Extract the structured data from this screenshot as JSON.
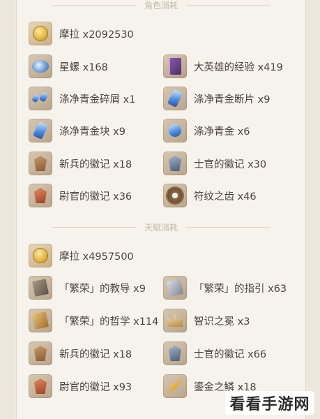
{
  "sections": [
    {
      "title": "角色消耗"
    },
    {
      "title": "天赋消耗"
    }
  ],
  "character_items": [
    {
      "icon": "mora-coin-icon",
      "label": "摩拉 x2092530"
    },
    {
      "icon": "wanderers-advice-icon",
      "label": "星螺 x168"
    },
    {
      "icon": "heros-wit-book-icon",
      "label": "大英雄的经验 x419"
    },
    {
      "icon": "gem-sliver-icon",
      "label": "涤净青金碎屑 x1"
    },
    {
      "icon": "gem-fragment-icon",
      "label": "涤净青金断片 x9"
    },
    {
      "icon": "gem-chunk-icon",
      "label": "涤净青金块 x9"
    },
    {
      "icon": "gem-gemstone-icon",
      "label": "涤净青金 x6"
    },
    {
      "icon": "recruit-insignia-icon",
      "label": "新兵的徽记 x18"
    },
    {
      "icon": "sergeant-insignia-icon",
      "label": "士官的徽记 x30"
    },
    {
      "icon": "lieutenant-insignia-icon",
      "label": "尉官的徽记 x36"
    },
    {
      "icon": "rune-tooth-icon",
      "label": "符纹之齿 x46"
    }
  ],
  "talent_items": [
    {
      "icon": "mora-coin-icon",
      "label": "摩拉 x4957500"
    },
    {
      "icon": "teachings-book-icon",
      "label": "「繁荣」的教导 x9"
    },
    {
      "icon": "guide-book-icon",
      "label": "「繁荣」的指引 x63"
    },
    {
      "icon": "philosophies-book-icon",
      "label": "「繁荣」的哲学 x114"
    },
    {
      "icon": "crown-of-insight-icon",
      "label": "智识之冕 x3"
    },
    {
      "icon": "recruit-insignia-icon",
      "label": "新兵的徽记 x18"
    },
    {
      "icon": "sergeant-insignia-icon",
      "label": "士官的徽记 x66"
    },
    {
      "icon": "lieutenant-insignia-icon",
      "label": "尉官的徽记 x93"
    },
    {
      "icon": "alchemy-scale-icon",
      "label": "鎏金之鳞 x18"
    }
  ],
  "watermark": "看看手游网"
}
